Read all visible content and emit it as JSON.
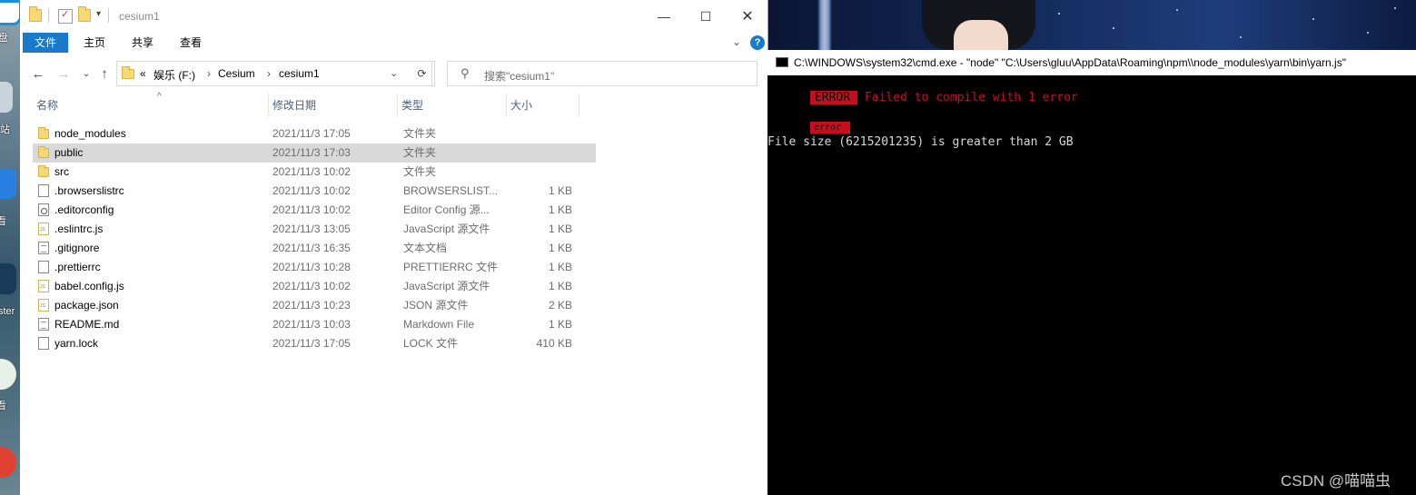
{
  "explorer": {
    "title": "cesium1",
    "ribbon_tabs": [
      "文件",
      "主页",
      "共享",
      "查看"
    ],
    "breadcrumb_prefix": "«",
    "breadcrumb": [
      "娱乐 (F:)",
      "Cesium",
      "cesium1"
    ],
    "search_placeholder": "搜索\"cesium1\"",
    "columns": [
      "名称",
      "修改日期",
      "类型",
      "大小"
    ],
    "files": [
      {
        "name": "node_modules",
        "date": "2021/11/3 17:05",
        "type": "文件夹",
        "size": "",
        "icon": "folder-icon"
      },
      {
        "name": "public",
        "date": "2021/11/3 17:03",
        "type": "文件夹",
        "size": "",
        "icon": "folder-icon"
      },
      {
        "name": "src",
        "date": "2021/11/3 10:02",
        "type": "文件夹",
        "size": "",
        "icon": "folder-icon"
      },
      {
        "name": ".browserslistrc",
        "date": "2021/11/3 10:02",
        "type": "BROWSERSLIST...",
        "size": "1 KB",
        "icon": "file-icon"
      },
      {
        "name": ".editorconfig",
        "date": "2021/11/3 10:02",
        "type": "Editor Config 源...",
        "size": "1 KB",
        "icon": "config-file-icon"
      },
      {
        "name": ".eslintrc.js",
        "date": "2021/11/3 13:05",
        "type": "JavaScript 源文件",
        "size": "1 KB",
        "icon": "js-file-icon"
      },
      {
        "name": ".gitignore",
        "date": "2021/11/3 16:35",
        "type": "文本文档",
        "size": "1 KB",
        "icon": "text-file-icon"
      },
      {
        "name": ".prettierrc",
        "date": "2021/11/3 10:28",
        "type": "PRETTIERRC 文件",
        "size": "1 KB",
        "icon": "file-icon"
      },
      {
        "name": "babel.config.js",
        "date": "2021/11/3 10:02",
        "type": "JavaScript 源文件",
        "size": "1 KB",
        "icon": "js-file-icon"
      },
      {
        "name": "package.json",
        "date": "2021/11/3 10:23",
        "type": "JSON 源文件",
        "size": "2 KB",
        "icon": "js-file-icon"
      },
      {
        "name": "README.md",
        "date": "2021/11/3 10:03",
        "type": "Markdown File",
        "size": "1 KB",
        "icon": "text-file-icon"
      },
      {
        "name": "yarn.lock",
        "date": "2021/11/3 17:05",
        "type": "LOCK 文件",
        "size": "410 KB",
        "icon": "file-icon"
      }
    ],
    "selected_row": "public"
  },
  "cmd": {
    "title": "C:\\WINDOWS\\system32\\cmd.exe  - \"node\"   \"C:\\Users\\gluu\\AppData\\Roaming\\npm\\\\node_modules\\yarn\\bin\\yarn.js\"",
    "error_badge": "ERROR",
    "error_message": "Failed to compile with 1 error",
    "small_badge": "error",
    "detail": "File size (6215201235) is greater than 2 GB"
  },
  "desktop": {
    "labels": [
      "盘",
      "站",
      "看",
      "ster",
      "看"
    ]
  },
  "watermark": "CSDN @喵喵虫",
  "colors": {
    "accent": "#1979ca",
    "cmd_error": "#c50f1f",
    "selection": "#d9d9d9"
  }
}
